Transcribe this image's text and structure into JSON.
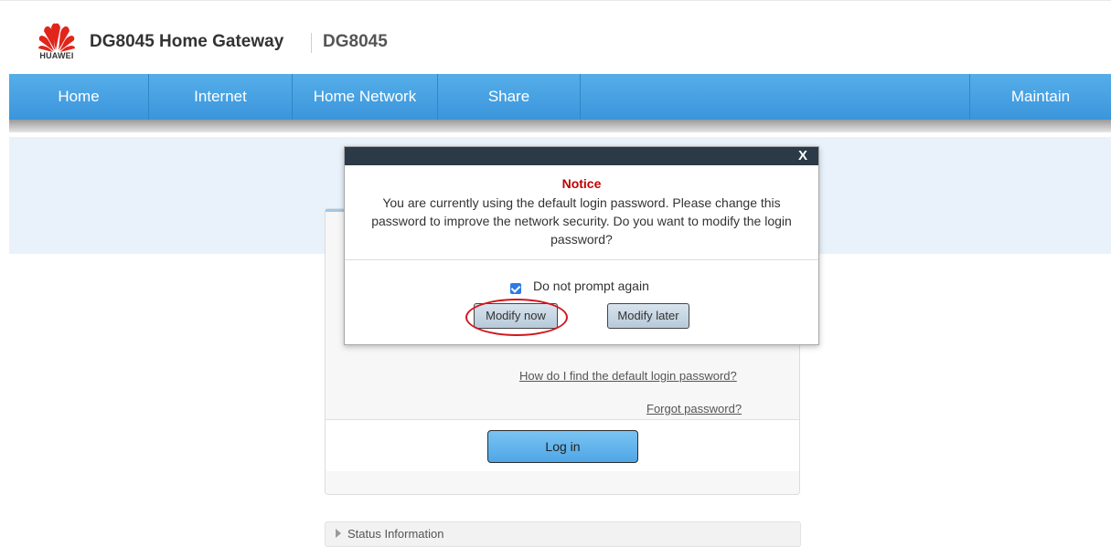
{
  "header": {
    "logo_text": "HUAWEI",
    "product_title": "DG8045 Home Gateway",
    "model": "DG8045"
  },
  "nav": {
    "items": [
      "Home",
      "Internet",
      "Home Network",
      "Share",
      "Maintain"
    ]
  },
  "login_card": {
    "default_password_link": "How do I find the default login password?",
    "forgot_password_link": "Forgot password?",
    "login_button": "Log in"
  },
  "status_section": {
    "label": "Status Information"
  },
  "dialog": {
    "close_label": "X",
    "title": "Notice",
    "message": "You are currently using the default login password. Please change this password to improve the network security. Do you want to modify the login password?",
    "checkbox_label": "Do not prompt again",
    "checkbox_checked": true,
    "modify_now_label": "Modify now",
    "modify_later_label": "Modify later"
  },
  "colors": {
    "nav_blue": "#3a95db",
    "notice_red": "#c00000",
    "annotation_red": "#d2161e",
    "huawei_red": "#e1251b"
  },
  "icons": [
    "huawei-logo-icon",
    "expand-arrow-icon",
    "checkbox-checked-icon"
  ]
}
